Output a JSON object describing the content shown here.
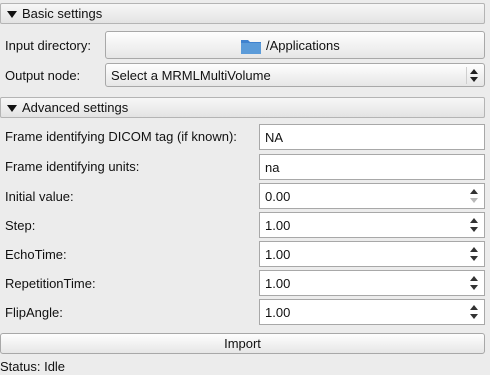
{
  "basic": {
    "header": "Basic settings",
    "input_dir_label": "Input directory:",
    "input_dir_value": "/Applications",
    "output_node_label": "Output node:",
    "output_node_value": "Select a MRMLMultiVolume"
  },
  "advanced": {
    "header": "Advanced settings",
    "dicom_tag_label": "Frame identifying DICOM tag (if known):",
    "dicom_tag_value": "NA",
    "units_label": "Frame identifying units:",
    "units_value": "na",
    "spinboxes": [
      {
        "label": "Initial value:",
        "value": "0.00"
      },
      {
        "label": "Step:",
        "value": "1.00"
      },
      {
        "label": "EchoTime:",
        "value": "1.00"
      },
      {
        "label": "RepetitionTime:",
        "value": "1.00"
      },
      {
        "label": "FlipAngle:",
        "value": "1.00"
      }
    ]
  },
  "import_label": "Import",
  "status": "Status: Idle",
  "icons": {
    "folder": "folder-icon"
  },
  "colors": {
    "folder_blue": "#5b9bd9"
  }
}
